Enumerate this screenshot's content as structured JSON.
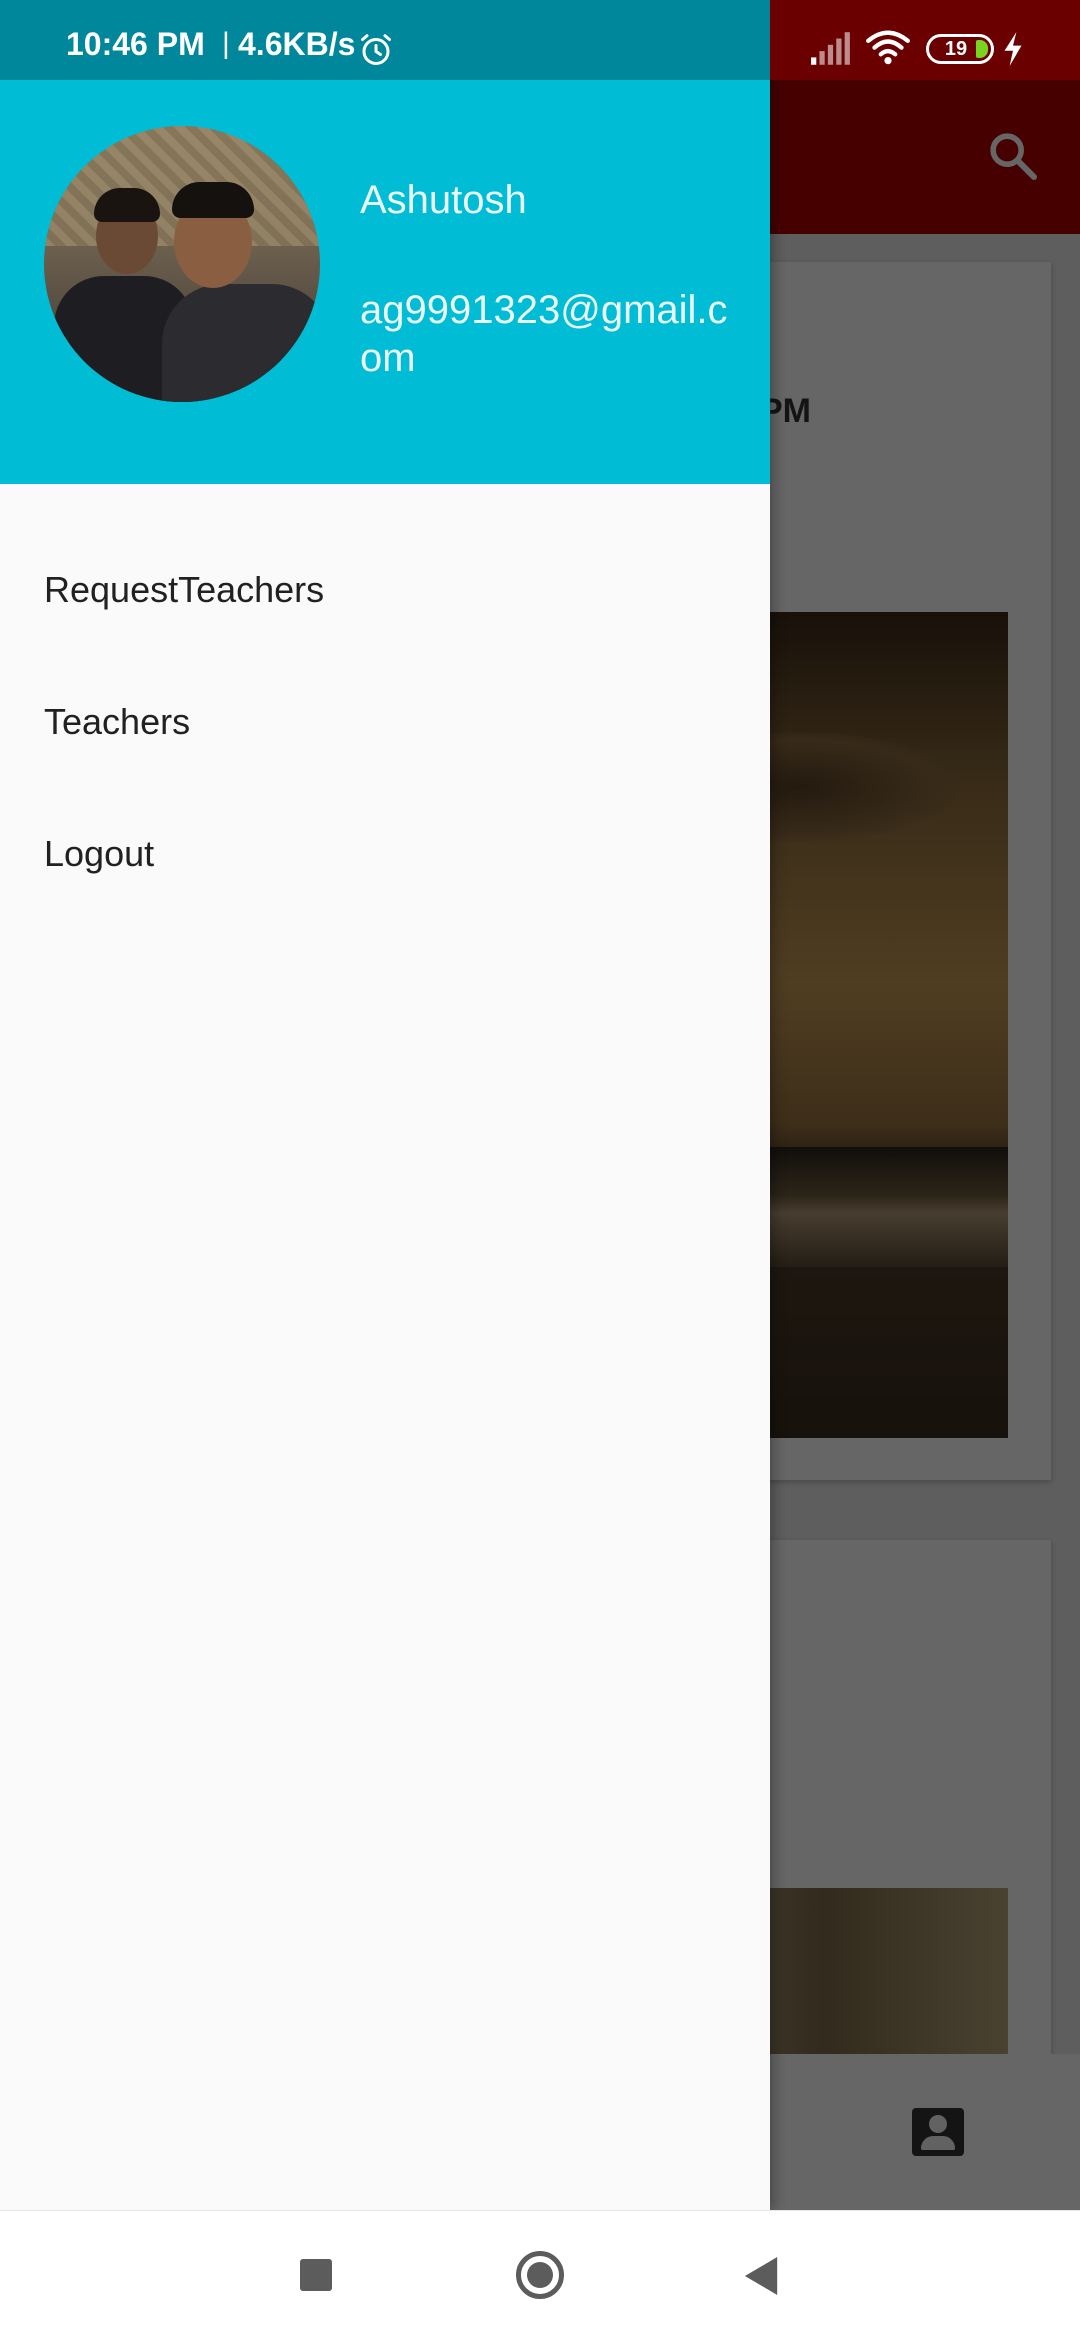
{
  "status_bar": {
    "time": "10:46 PM",
    "separator": "|",
    "network_speed": "4.6KB/s",
    "battery_level": "19",
    "icons": [
      "alarm-icon",
      "signal-icon",
      "wifi-icon",
      "battery-icon",
      "charging-icon"
    ],
    "left_bg_color": "#00879b",
    "right_bg_color": "#6a0000"
  },
  "drawer": {
    "header": {
      "background_color": "#00bcd4",
      "name": "Ashutosh",
      "email": "ag9991323@gmail.com"
    },
    "menu": {
      "items": [
        {
          "label": "RequestTeachers"
        },
        {
          "label": "Teachers"
        },
        {
          "label": "Logout"
        }
      ]
    }
  },
  "background_app": {
    "toolbar_color": "#b00000",
    "card_time_fragment": "PM",
    "icons": [
      "search-icon",
      "account-icon"
    ]
  },
  "nav_bar": {
    "icons": [
      "recents-icon",
      "home-icon",
      "back-icon"
    ]
  }
}
